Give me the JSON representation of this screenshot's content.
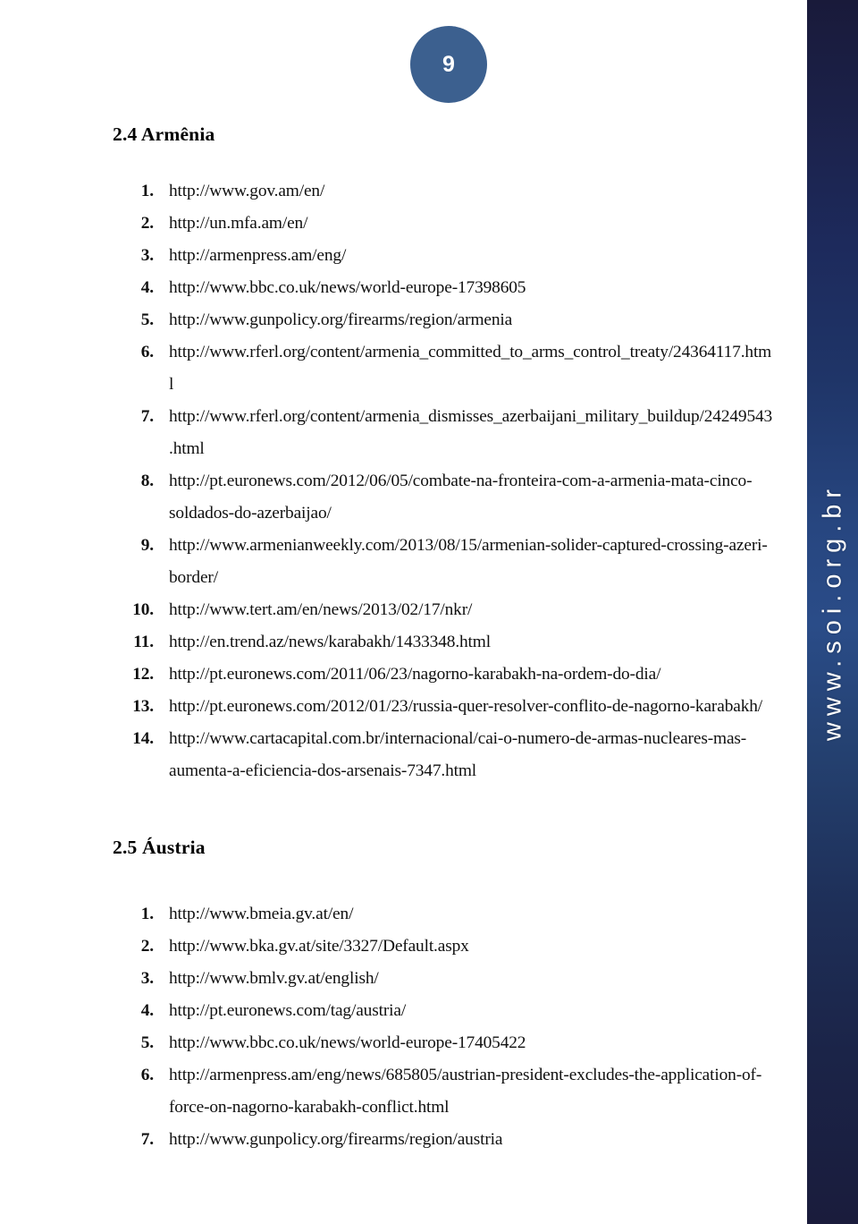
{
  "page": {
    "number": "9",
    "badge_color": "#3c608f"
  },
  "sidebar": {
    "brand_text": "www.soi.org.br",
    "gradient_top_color": "#191a3a",
    "gradient_mid_color": "#2a4c88",
    "gradient_bottom_color": "#1a1c3c"
  },
  "sections": [
    {
      "heading": "2.4 Armênia",
      "items": [
        {
          "num": "1.",
          "url": "http://www.gov.am/en/"
        },
        {
          "num": "2.",
          "url": "http://un.mfa.am/en/"
        },
        {
          "num": "3.",
          "url": "http://armenpress.am/eng/"
        },
        {
          "num": "4.",
          "url": "http://www.bbc.co.uk/news/world-europe-17398605"
        },
        {
          "num": "5.",
          "url": "http://www.gunpolicy.org/firearms/region/armenia"
        },
        {
          "num": "6.",
          "url": "http://www.rferl.org/content/armenia_committed_to_arms_control_treaty/24364117.html"
        },
        {
          "num": "7.",
          "url": "http://www.rferl.org/content/armenia_dismisses_azerbaijani_military_buildup/24249543.html"
        },
        {
          "num": "8.",
          "url": "http://pt.euronews.com/2012/06/05/combate-na-fronteira-com-a-armenia-mata-cinco-soldados-do-azerbaijao/"
        },
        {
          "num": "9.",
          "url": "http://www.armenianweekly.com/2013/08/15/armenian-solider-captured-crossing-azeri-border/"
        },
        {
          "num": "10.",
          "url": "http://www.tert.am/en/news/2013/02/17/nkr/"
        },
        {
          "num": "11.",
          "url": "http://en.trend.az/news/karabakh/1433348.html"
        },
        {
          "num": "12.",
          "url": "http://pt.euronews.com/2011/06/23/nagorno-karabakh-na-ordem-do-dia/"
        },
        {
          "num": "13.",
          "url": "http://pt.euronews.com/2012/01/23/russia-quer-resolver-conflito-de-nagorno-karabakh/"
        },
        {
          "num": "14.",
          "url": "http://www.cartacapital.com.br/internacional/cai-o-numero-de-armas-nucleares-mas-aumenta-a-eficiencia-dos-arsenais-7347.html"
        }
      ]
    },
    {
      "heading": "2.5 Áustria",
      "items": [
        {
          "num": "1.",
          "url": "http://www.bmeia.gv.at/en/"
        },
        {
          "num": "2.",
          "url": "http://www.bka.gv.at/site/3327/Default.aspx"
        },
        {
          "num": "3.",
          "url": "http://www.bmlv.gv.at/english/"
        },
        {
          "num": "4.",
          "url": "http://pt.euronews.com/tag/austria/"
        },
        {
          "num": "5.",
          "url": "http://www.bbc.co.uk/news/world-europe-17405422"
        },
        {
          "num": "6.",
          "url": "http://armenpress.am/eng/news/685805/austrian-president-excludes-the-application-of-force-on-nagorno-karabakh-conflict.html"
        },
        {
          "num": "7.",
          "url": "http://www.gunpolicy.org/firearms/region/austria"
        }
      ]
    }
  ]
}
